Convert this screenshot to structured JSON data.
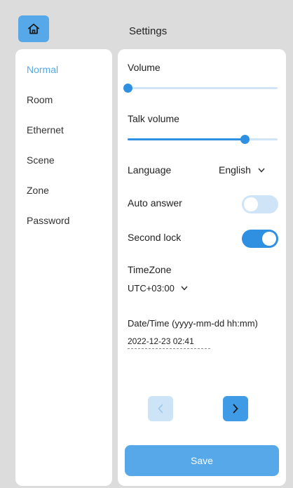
{
  "header": {
    "title": "Settings"
  },
  "sidebar": {
    "items": [
      {
        "label": "Normal",
        "active": true
      },
      {
        "label": "Room"
      },
      {
        "label": "Ethernet"
      },
      {
        "label": "Scene"
      },
      {
        "label": "Zone"
      },
      {
        "label": "Password"
      }
    ]
  },
  "settings": {
    "volume": {
      "label": "Volume",
      "level": 0.0
    },
    "talk_volume": {
      "label": "Talk volume",
      "level": 0.78
    },
    "language": {
      "label": "Language",
      "value": "English"
    },
    "auto_answer": {
      "label": "Auto answer",
      "on": false
    },
    "second_lock": {
      "label": "Second lock",
      "on": true
    },
    "timezone": {
      "label": "TimeZone",
      "value": "UTC+03:00"
    },
    "datetime": {
      "label": "Date/Time (yyyy-mm-dd hh:mm)",
      "value": "2022-12-23 02:41"
    }
  },
  "buttons": {
    "save": "Save"
  },
  "icons": {
    "home": "home-icon",
    "prev": "chevron-left-icon",
    "next": "chevron-right-icon",
    "dropdown": "chevron-down-icon"
  },
  "colors": {
    "accent": "#56a8e8",
    "accent_strong": "#2f8fe0",
    "accent_light": "#cfe5f7",
    "background": "#dcdcdc",
    "panel": "#ffffff"
  }
}
